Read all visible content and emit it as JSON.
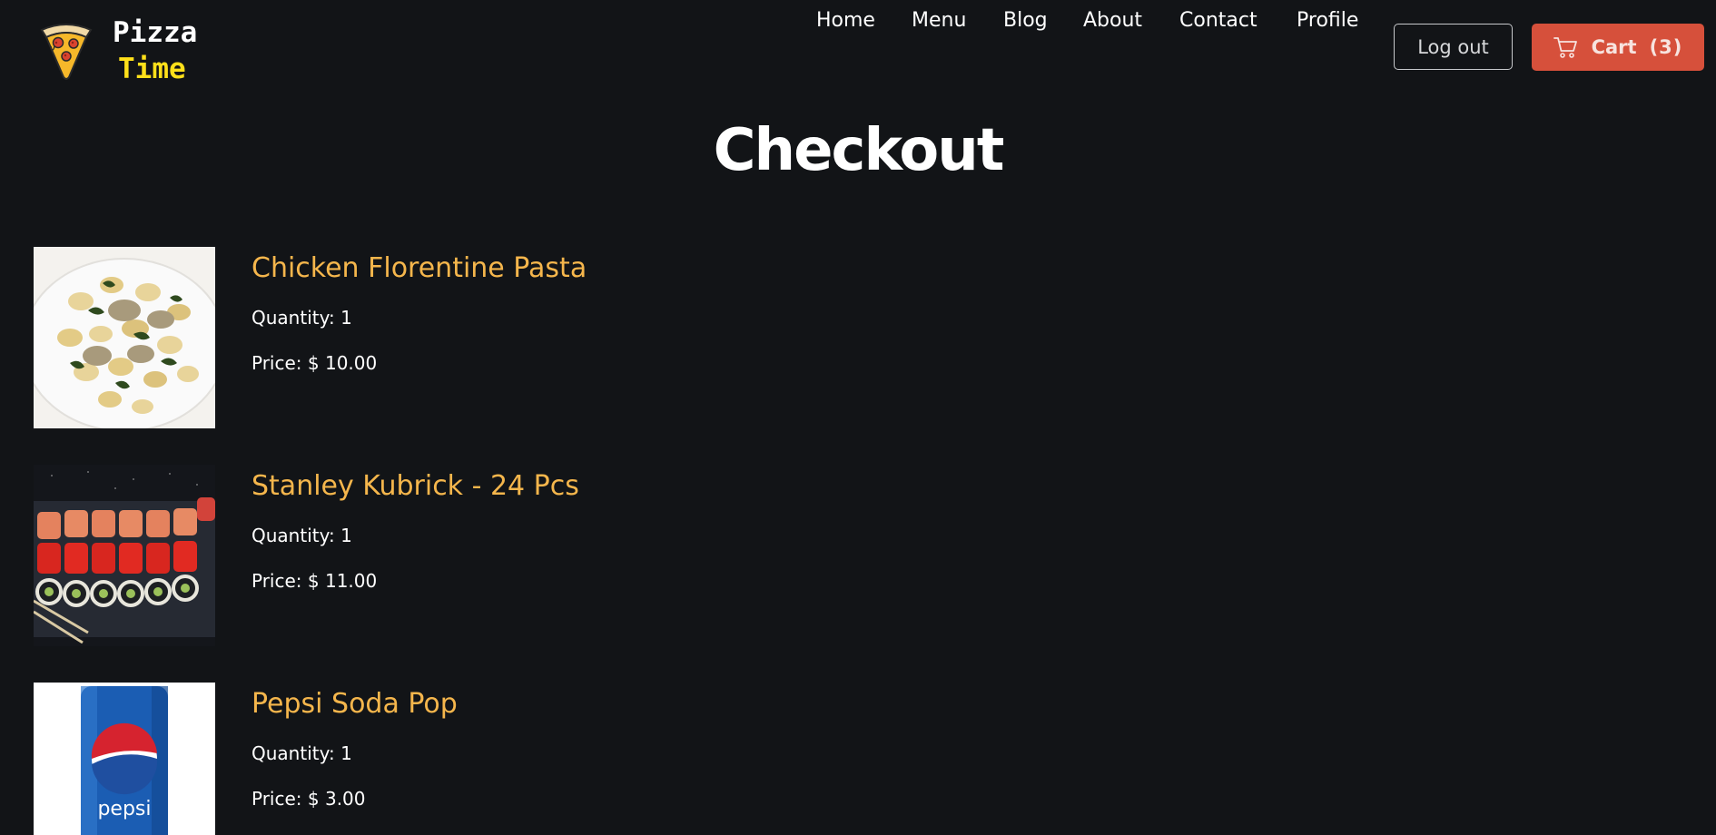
{
  "brand": {
    "line1": "Pizza",
    "line2": "Time",
    "logo_icon": "pizza-slice-icon"
  },
  "nav": {
    "links": [
      {
        "label": "Home"
      },
      {
        "label": "Menu"
      },
      {
        "label": "Blog"
      },
      {
        "label": "About"
      },
      {
        "label": "Contact"
      },
      {
        "label": "Profile"
      }
    ],
    "logout_label": "Log out",
    "cart_label": "Cart",
    "cart_count": "(3)",
    "cart_icon": "shopping-cart-icon"
  },
  "page": {
    "title": "Checkout"
  },
  "items": [
    {
      "name": "Chicken Florentine Pasta",
      "quantity_text": "Quantity: 1",
      "price_text": "Price: $ 10.00",
      "image": "pasta-photo"
    },
    {
      "name": "Stanley Kubrick - 24 Pcs",
      "quantity_text": "Quantity: 1",
      "price_text": "Price: $ 11.00",
      "image": "sushi-photo"
    },
    {
      "name": "Pepsi Soda Pop",
      "quantity_text": "Quantity: 1",
      "price_text": "Price: $ 3.00",
      "image": "pepsi-can-photo",
      "image_text": "pepsi"
    }
  ],
  "colors": {
    "background": "#121417",
    "accent_orange": "#f5b64c",
    "cart_button": "#d6503b",
    "brand_yellow": "#ffe01a"
  }
}
